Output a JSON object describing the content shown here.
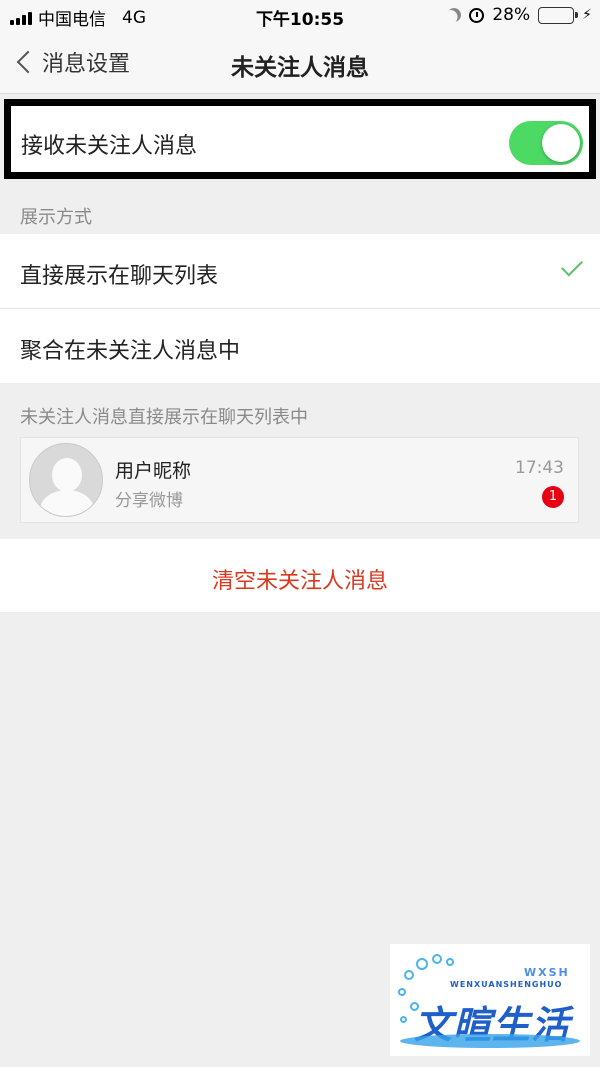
{
  "status_bar": {
    "carrier": "中国电信",
    "network": "4G",
    "time": "下午10:55",
    "battery_percent": "28%",
    "battery_level": 0.28
  },
  "nav": {
    "back_label": "消息设置",
    "title": "未关注人消息"
  },
  "receive_toggle": {
    "label": "接收未关注人消息",
    "on": true,
    "on_color": "#4cd964"
  },
  "display_section": {
    "header": "展示方式",
    "options": [
      {
        "label": "直接展示在聊天列表",
        "selected": true
      },
      {
        "label": "聚合在未关注人消息中",
        "selected": false
      }
    ]
  },
  "preview": {
    "caption": "未关注人消息直接展示在聊天列表中",
    "nickname": "用户昵称",
    "subtitle": "分享微博",
    "time": "17:43",
    "badge_count": "1"
  },
  "clear_button": {
    "label": "清空未关注人消息",
    "color": "#d93a1f"
  },
  "watermark": {
    "title": "文暄生活",
    "subtitle": "WENXUANSHENGHUO",
    "abbr": "WXSH"
  }
}
